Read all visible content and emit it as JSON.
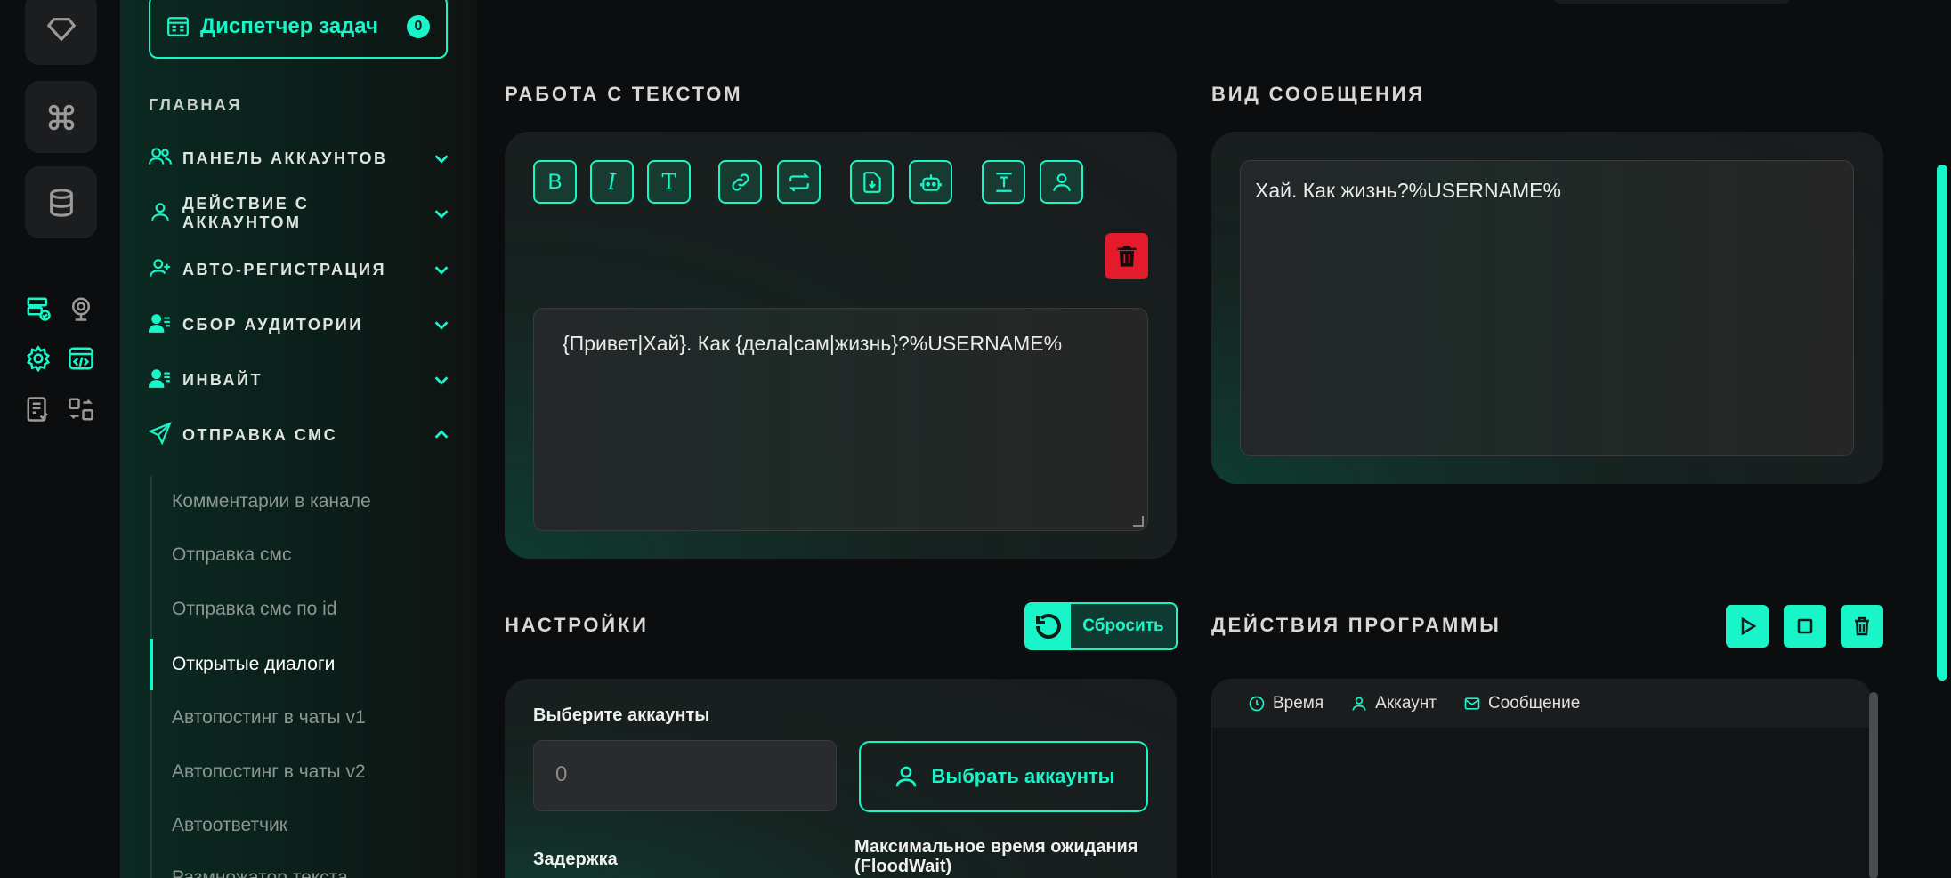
{
  "colors": {
    "accent": "#19f5c8",
    "danger": "#e31b2d",
    "background": "#0c0d0e"
  },
  "rail": {
    "top_icons": [
      "diamond-icon",
      "command-icon",
      "database-icon"
    ],
    "small_icons": [
      "server-check-icon",
      "webcam-icon",
      "settings-gear-icon",
      "code-window-icon",
      "checklist-icon",
      "transfer-icon"
    ]
  },
  "sidebar": {
    "task_manager": {
      "label": "Диспетчер задач",
      "count": "0"
    },
    "section_title": "ГЛАВНАЯ",
    "nav": [
      {
        "label": "ПАНЕЛЬ АККАУНТОВ",
        "icon": "users-icon",
        "expanded": false
      },
      {
        "label": "ДЕЙСТВИЕ С АККАУНТОМ",
        "icon": "user-icon",
        "expanded": false
      },
      {
        "label": "АВТО-РЕГИСТРАЦИЯ",
        "icon": "user-add-icon",
        "expanded": false
      },
      {
        "label": "СБОР АУДИТОРИИ",
        "icon": "user-list-icon",
        "expanded": false
      },
      {
        "label": "ИНВАЙТ",
        "icon": "user-list-icon",
        "expanded": false
      },
      {
        "label": "ОТПРАВКА СМС",
        "icon": "send-icon",
        "expanded": true
      }
    ],
    "sub_items": [
      {
        "label": "Комментарии в канале",
        "active": false
      },
      {
        "label": "Отправка смс",
        "active": false
      },
      {
        "label": "Отправка смс по id",
        "active": false
      },
      {
        "label": "Открытые диалоги",
        "active": true
      },
      {
        "label": "Автопостинг в чаты v1",
        "active": false
      },
      {
        "label": "Автопостинг в чаты v2",
        "active": false
      },
      {
        "label": "Автоответчик",
        "active": false
      },
      {
        "label": "Размножатор текста",
        "active": false
      }
    ]
  },
  "text_work": {
    "title": "РАБОТА С ТЕКСТОМ",
    "toolbar": [
      "B",
      "I",
      "T",
      "link-icon",
      "repeat-icon",
      "file-download-icon",
      "bot-icon",
      "text-format-icon",
      "user-icon"
    ],
    "text": "{Привет|Хай}. Как {дела|сам|жизнь}?%USERNAME%"
  },
  "preview": {
    "title": "ВИД СООБЩЕНИЯ",
    "text": "Хай. Как жизнь?%USERNAME%"
  },
  "settings": {
    "title": "НАСТРОЙКИ",
    "reset_label": "Сбросить",
    "accounts_label": "Выберите аккаунты",
    "accounts_placeholder": "0",
    "select_accounts_label": "Выбрать аккаунты",
    "delay_label": "Задержка",
    "floodwait_label": "Максимальное время ожидания (FloodWait)"
  },
  "actions": {
    "title": "ДЕЙСТВИЯ ПРОГРАММЫ",
    "columns": [
      "Время",
      "Аккаунт",
      "Сообщение"
    ]
  }
}
